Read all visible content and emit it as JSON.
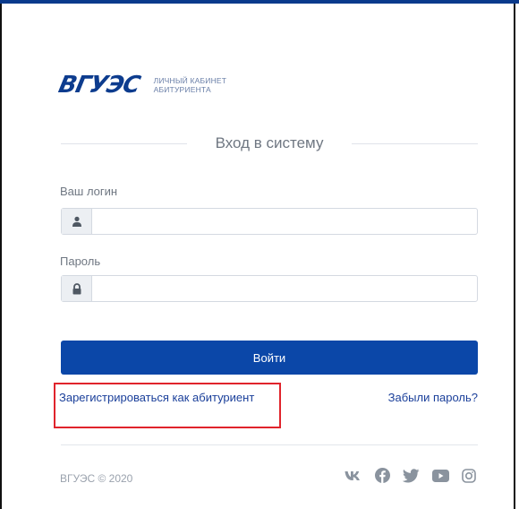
{
  "logo": {
    "mark": "ВГУЭС",
    "subtitle_line1": "ЛИЧНЫЙ КАБИНЕТ",
    "subtitle_line2": "АБИТУРИЕНТА",
    "color": "#0d3c8e"
  },
  "form": {
    "title": "Вход в систему",
    "login_label": "Ваш логин",
    "login_value": "",
    "login_icon": "user-icon",
    "password_label": "Пароль",
    "password_value": "",
    "password_icon": "lock-icon",
    "submit_label": "Войти"
  },
  "links": {
    "register": "Зарегистрироваться как абитуриент",
    "forgot": "Забыли пароль?"
  },
  "footer": {
    "copyright": "ВГУЭС © 2020",
    "socials": [
      "vk-icon",
      "facebook-icon",
      "twitter-icon",
      "youtube-icon",
      "instagram-icon"
    ]
  },
  "colors": {
    "primary": "#0b47a8",
    "link": "#1a3f9a",
    "highlight": "#e0242c"
  }
}
